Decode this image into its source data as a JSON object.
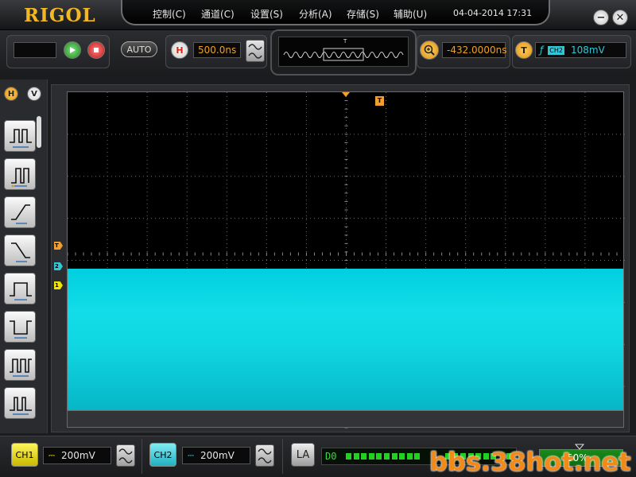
{
  "app": {
    "brand": "RIGOL"
  },
  "menu": {
    "items": [
      "控制(C)",
      "通道(C)",
      "设置(S)",
      "分析(A)",
      "存储(S)",
      "辅助(U)"
    ],
    "datetime": "04-04-2014  17:31"
  },
  "window_controls": {
    "minimize_symbol": "−",
    "close_symbol": "✕"
  },
  "toolbar": {
    "auto_label": "AUTO",
    "horizontal_badge": "H",
    "timebase": "500.0ns",
    "overview_marker": "T",
    "offset": "-432.0000ns",
    "trigger_badge": "T",
    "trigger_edge_symbol": "ƒ",
    "trigger_source": "CH2",
    "trigger_level": "108mV"
  },
  "left_panel": {
    "tab_h": "H",
    "tab_v": "V",
    "trigger_icons": [
      "edge-trigger-icon",
      "pulse-trigger-icon",
      "slope-rise-icon",
      "slope-fall-icon",
      "positive-pulse-icon",
      "negative-pulse-icon",
      "pattern-trigger-icon",
      "runt-trigger-icon"
    ]
  },
  "screen": {
    "trigger_pos_marker": "T",
    "marker_t": "T",
    "marker_ch2": "2",
    "marker_ch1": "1",
    "waveform_color": "#10d6e2",
    "ch1_color": "#f0e400",
    "ch2_color": "#30c8d8",
    "trigger_color": "#f0a030"
  },
  "bottom": {
    "ch1_label": "CH1",
    "ch1_coupling": "⎓",
    "ch1_scale": "200mV",
    "ch2_label": "CH2",
    "ch2_coupling": "⎓",
    "ch2_scale": "200mV",
    "la_label": "LA",
    "d0_label": "D0",
    "mem_percent": "50%",
    "watermark": "bbs.38hot.net"
  }
}
